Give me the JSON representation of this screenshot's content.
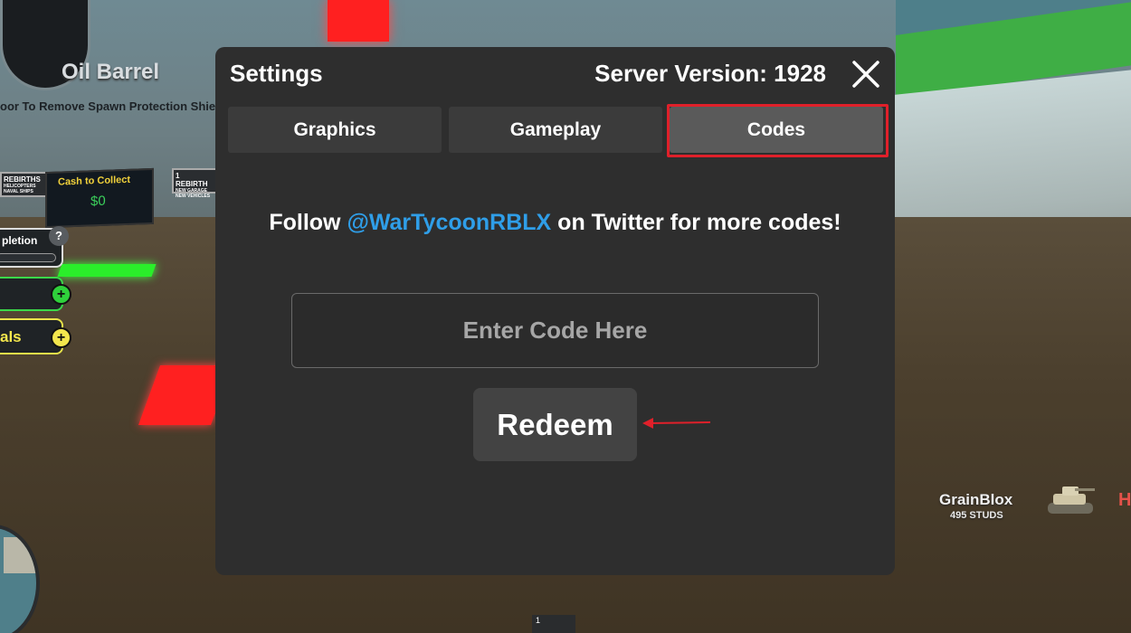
{
  "background": {
    "label_top": "Oil Barrel",
    "label_sub": "oor To Remove Spawn Protection Shield",
    "rebirth_left": "REBIRTHS",
    "rebirth_left_sub": "HELICOPTERS NAVAL SHIPS",
    "rebirth_right": "1 REBIRTH",
    "rebirth_right_sub": "NEW GARAGE NEW VEHICLES",
    "cash_title": "Cash to Collect",
    "cash_value": "$0",
    "completion_label": "pletion",
    "help_symbol": "?",
    "side_label": "als",
    "plus_symbol": "+",
    "player_name": "GrainBlox",
    "player_distance": "495 STUDS",
    "partial_letter": "H",
    "hotbar_number": "1"
  },
  "settings": {
    "title": "Settings",
    "server_version": "Server Version: 1928",
    "tabs": [
      {
        "label": "Graphics",
        "active": false
      },
      {
        "label": "Gameplay",
        "active": false
      },
      {
        "label": "Codes",
        "active": true
      }
    ],
    "follow_prefix": "Follow ",
    "follow_handle": "@WarTycoonRBLX",
    "follow_suffix": " on Twitter for more codes!",
    "code_input": {
      "value": "",
      "placeholder": "Enter Code Here"
    },
    "redeem_label": "Redeem"
  },
  "colors": {
    "panel": "#2e2e2e",
    "tab": "#3b3b3b",
    "tab_active": "#5a5a5a",
    "highlight": "#e0202a",
    "twitter_handle": "#2f9ee8"
  },
  "icons": [
    "close-icon",
    "arrow-left-icon",
    "shield-icon",
    "tank-icon"
  ]
}
